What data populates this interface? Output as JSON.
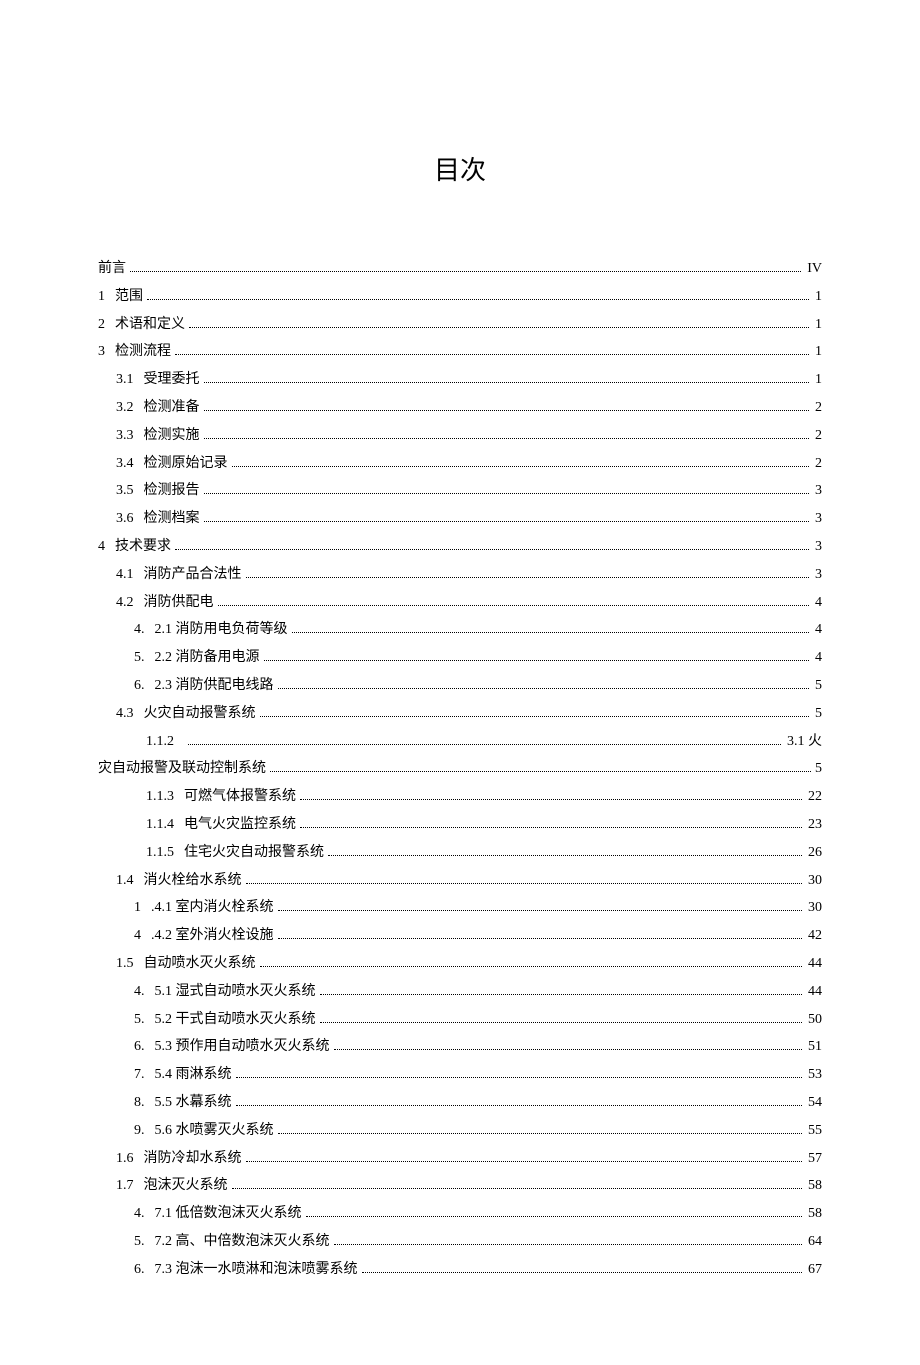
{
  "title": "目次",
  "entries": [
    {
      "indent": 0,
      "num": "",
      "label": "前言",
      "page": "IV"
    },
    {
      "indent": 0,
      "num": "1",
      "label": "范围",
      "page": "1"
    },
    {
      "indent": 0,
      "num": "2",
      "label": "术语和定义",
      "page": "1"
    },
    {
      "indent": 0,
      "num": "3",
      "label": "检测流程",
      "page": "1"
    },
    {
      "indent": 1,
      "num": "3.1",
      "label": "受理委托",
      "page": "1"
    },
    {
      "indent": 1,
      "num": "3.2",
      "label": "检测准备",
      "page": "2"
    },
    {
      "indent": 1,
      "num": "3.3",
      "label": "检测实施",
      "page": "2"
    },
    {
      "indent": 1,
      "num": "3.4",
      "label": "检测原始记录",
      "page": "2"
    },
    {
      "indent": 1,
      "num": "3.5",
      "label": "检测报告",
      "page": "3"
    },
    {
      "indent": 1,
      "num": "3.6",
      "label": "检测档案",
      "page": "3"
    },
    {
      "indent": 0,
      "num": "4",
      "label": "技术要求",
      "page": "3"
    },
    {
      "indent": 1,
      "num": "4.1",
      "label": "消防产品合法性",
      "page": "3"
    },
    {
      "indent": 1,
      "num": "4.2",
      "label": "消防供配电",
      "page": "4"
    },
    {
      "indent": 2,
      "num": "4.",
      "label": "2.1 消防用电负荷等级",
      "page": "4"
    },
    {
      "indent": 2,
      "num": "5.",
      "label": "2.2 消防备用电源",
      "page": "4"
    },
    {
      "indent": 2,
      "num": "6.",
      "label": "2.3 消防供配电线路",
      "page": "5"
    },
    {
      "indent": 1,
      "num": "4.3",
      "label": "火灾自动报警系统",
      "page": "5"
    }
  ],
  "wrapped": {
    "first_num": "1.1.2",
    "first_tail": "3.1  火",
    "second_label": "灾自动报警及联动控制系统",
    "second_page": "5"
  },
  "entries2": [
    {
      "indent": 3,
      "num": "1.1.3",
      "label": "可燃气体报警系统",
      "page": "22"
    },
    {
      "indent": 3,
      "num": "1.1.4",
      "label": "电气火灾监控系统",
      "page": "23"
    },
    {
      "indent": 3,
      "num": "1.1.5",
      "label": "住宅火灾自动报警系统",
      "page": "26"
    },
    {
      "indent": 1,
      "num": "1.4",
      "label": "消火栓给水系统",
      "page": "30"
    },
    {
      "indent": 2,
      "num": "1",
      "label": ".4.1 室内消火栓系统",
      "page": "30"
    },
    {
      "indent": 2,
      "num": "4",
      "label": ".4.2 室外消火栓设施",
      "page": "42"
    },
    {
      "indent": 1,
      "num": "1.5",
      "label": "自动喷水灭火系统",
      "page": "44"
    },
    {
      "indent": 2,
      "num": "4.",
      "label": "5.1 湿式自动喷水灭火系统",
      "page": "44"
    },
    {
      "indent": 2,
      "num": "5.",
      "label": "5.2 干式自动喷水灭火系统",
      "page": "50"
    },
    {
      "indent": 2,
      "num": "6.",
      "label": "5.3 预作用自动喷水灭火系统",
      "page": "51"
    },
    {
      "indent": 2,
      "num": "7.",
      "label": "5.4 雨淋系统",
      "page": "53"
    },
    {
      "indent": 2,
      "num": "8.",
      "label": "5.5 水幕系统",
      "page": "54"
    },
    {
      "indent": 2,
      "num": "9.",
      "label": "5.6 水喷雾灭火系统",
      "page": "55"
    },
    {
      "indent": 1,
      "num": "1.6",
      "label": "消防冷却水系统",
      "page": "57"
    },
    {
      "indent": 1,
      "num": "1.7",
      "label": "泡沫灭火系统",
      "page": "58"
    },
    {
      "indent": 2,
      "num": "4.",
      "label": "7.1 低倍数泡沫灭火系统",
      "page": "58"
    },
    {
      "indent": 2,
      "num": "5.",
      "label": "7.2 高、中倍数泡沫灭火系统",
      "page": "64"
    },
    {
      "indent": 2,
      "num": "6.",
      "label": "7.3 泡沫一水喷淋和泡沫喷雾系统",
      "page": "67"
    }
  ]
}
